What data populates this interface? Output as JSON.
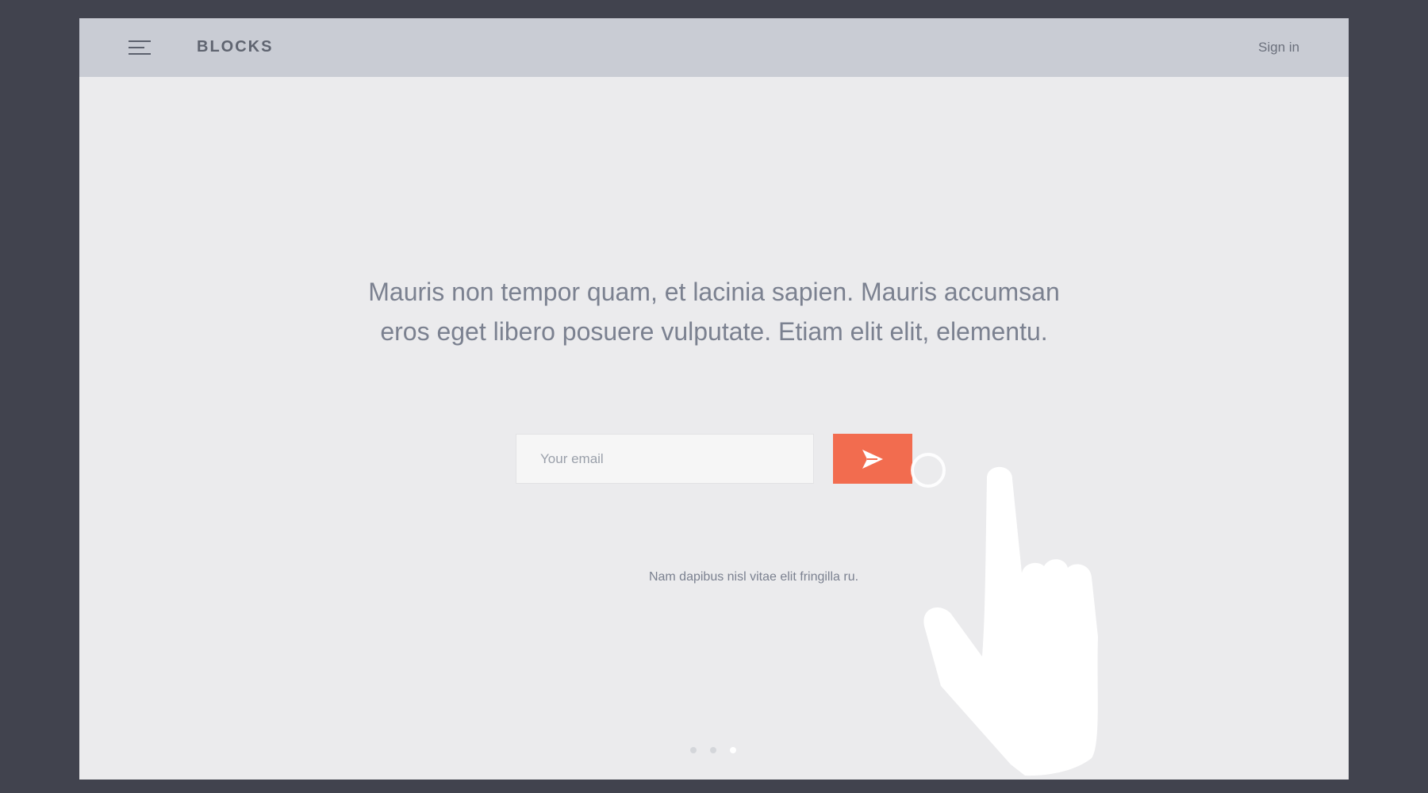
{
  "header": {
    "brand": "BLOCKS",
    "sign_in_label": "Sign in",
    "menu_icon": "hamburger-menu-icon"
  },
  "hero": {
    "headline_line1": "Mauris non tempor quam, et lacinia sapien. Mauris accumsan",
    "headline_line2": "eros eget libero posuere vulputate. Etiam elit elit, elementu.",
    "email_placeholder": "Your email",
    "email_value": "",
    "send_icon": "paper-plane-send-icon",
    "subtext": "Nam dapibus nisl vitae elit fringilla ru."
  },
  "pagination": {
    "total": 3,
    "active_index": 3
  },
  "overlay": {
    "icon": "pointing-hand-icon"
  },
  "colors": {
    "outer_background": "#41434e",
    "header_background": "#c9ccd4",
    "page_background": "#ebebed",
    "accent": "#f26c4f",
    "text_muted": "#7b8190"
  }
}
